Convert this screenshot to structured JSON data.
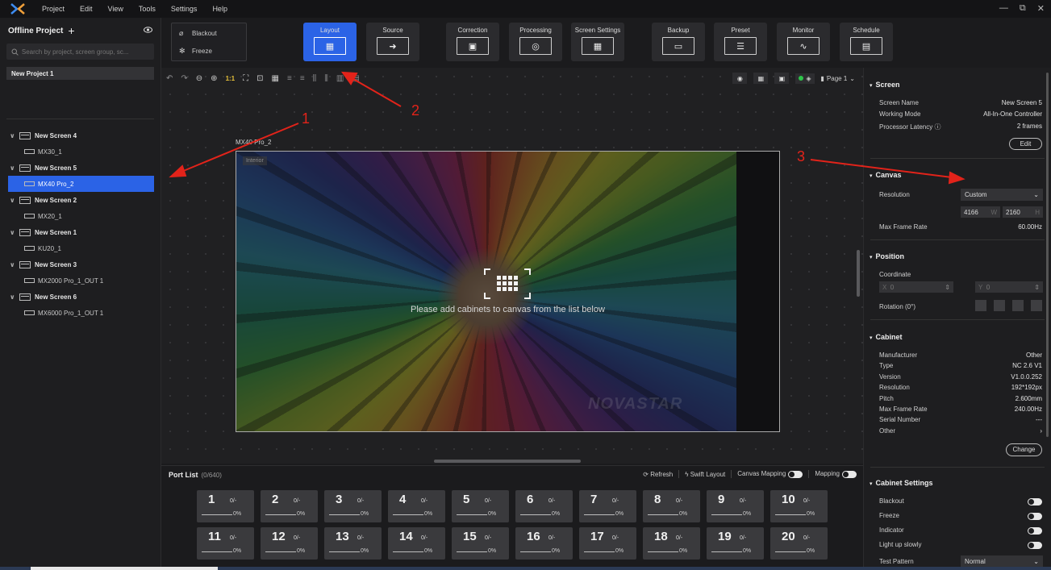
{
  "menu": {
    "items": [
      "Project",
      "Edit",
      "View",
      "Tools",
      "Settings",
      "Help"
    ],
    "window_controls": [
      "—",
      "⧉",
      "✕"
    ]
  },
  "sidebar": {
    "project_title": "Offline Project",
    "add_symbol": "+",
    "search_placeholder": "Search by project, screen group, sc...",
    "project_item": "New Project 1",
    "tree": [
      {
        "screen": "New Screen 4",
        "controller": "MX30_1",
        "selected": false
      },
      {
        "screen": "New Screen 5",
        "controller": "MX40 Pro_2",
        "selected": true
      },
      {
        "screen": "New Screen 2",
        "controller": "MX20_1",
        "selected": false
      },
      {
        "screen": "New Screen 1",
        "controller": "KU20_1",
        "selected": false
      },
      {
        "screen": "New Screen 3",
        "controller": "MX2000 Pro_1_OUT 1",
        "selected": false
      },
      {
        "screen": "New Screen 6",
        "controller": "MX6000 Pro_1_OUT 1",
        "selected": false
      }
    ]
  },
  "toolbar": {
    "blackout_label": "Blackout",
    "freeze_label": "Freeze",
    "tabs": [
      {
        "label": "Layout",
        "icon": "layout-grid-icon",
        "active": true
      },
      {
        "label": "Source",
        "icon": "arrow-right-icon",
        "active": false
      },
      {
        "label": "Correction",
        "icon": "correction-icon",
        "active": false
      },
      {
        "label": "Processing",
        "icon": "color-wheel-icon",
        "active": false
      },
      {
        "label": "Screen Settings",
        "icon": "screen-settings-icon",
        "active": false
      },
      {
        "label": "Backup",
        "icon": "backup-icon",
        "active": false
      },
      {
        "label": "Preset",
        "icon": "sliders-icon",
        "active": false
      },
      {
        "label": "Monitor",
        "icon": "monitor-icon",
        "active": false
      },
      {
        "label": "Schedule",
        "icon": "schedule-icon",
        "active": false
      }
    ]
  },
  "canvas": {
    "zoom_label": "1:1",
    "page_label": "Page 1",
    "screen_label": "MX40 Pro_2",
    "interior_tag": "Interior",
    "watermark": "NOVASTAR",
    "empty_message": "Please add cabinets to canvas from the list below"
  },
  "portlist": {
    "title": "Port List",
    "count": "(0/640)",
    "refresh": "Refresh",
    "swift_layout": "Swift Layout",
    "canvas_mapping": "Canvas Mapping",
    "mapping": "Mapping",
    "ports": [
      {
        "num": "1",
        "frac": "0/-",
        "pct": "0%"
      },
      {
        "num": "2",
        "frac": "0/-",
        "pct": "0%"
      },
      {
        "num": "3",
        "frac": "0/-",
        "pct": "0%"
      },
      {
        "num": "4",
        "frac": "0/-",
        "pct": "0%"
      },
      {
        "num": "5",
        "frac": "0/-",
        "pct": "0%"
      },
      {
        "num": "6",
        "frac": "0/-",
        "pct": "0%"
      },
      {
        "num": "7",
        "frac": "0/-",
        "pct": "0%"
      },
      {
        "num": "8",
        "frac": "0/-",
        "pct": "0%"
      },
      {
        "num": "9",
        "frac": "0/-",
        "pct": "0%"
      },
      {
        "num": "10",
        "frac": "0/-",
        "pct": "0%"
      },
      {
        "num": "11",
        "frac": "0/-",
        "pct": "0%"
      },
      {
        "num": "12",
        "frac": "0/-",
        "pct": "0%"
      },
      {
        "num": "13",
        "frac": "0/-",
        "pct": "0%"
      },
      {
        "num": "14",
        "frac": "0/-",
        "pct": "0%"
      },
      {
        "num": "15",
        "frac": "0/-",
        "pct": "0%"
      },
      {
        "num": "16",
        "frac": "0/-",
        "pct": "0%"
      },
      {
        "num": "17",
        "frac": "0/-",
        "pct": "0%"
      },
      {
        "num": "18",
        "frac": "0/-",
        "pct": "0%"
      },
      {
        "num": "19",
        "frac": "0/-",
        "pct": "0%"
      },
      {
        "num": "20",
        "frac": "0/-",
        "pct": "0%"
      }
    ]
  },
  "rightpanel": {
    "screen": {
      "title": "Screen",
      "name_label": "Screen Name",
      "name_value": "New Screen 5",
      "mode_label": "Working Mode",
      "mode_value": "All-In-One Controller",
      "latency_label": "Processor Latency",
      "latency_value": "2 frames",
      "edit_button": "Edit"
    },
    "canvas": {
      "title": "Canvas",
      "resolution_label": "Resolution",
      "resolution_value": "Custom",
      "width": "4166",
      "width_unit": "W",
      "height": "2160",
      "height_unit": "H",
      "max_frame_label": "Max Frame Rate",
      "max_frame_value": "60.00Hz"
    },
    "position": {
      "title": "Position",
      "coord_label": "Coordinate",
      "x_label": "X",
      "x_value": "0",
      "y_label": "Y",
      "y_value": "0",
      "rotation_label": "Rotation (0°)"
    },
    "cabinet": {
      "title": "Cabinet",
      "rows": [
        {
          "k": "Manufacturer",
          "v": "Other"
        },
        {
          "k": "Type",
          "v": "NC 2.6 V1"
        },
        {
          "k": "Version",
          "v": "V1.0.0.252"
        },
        {
          "k": "Resolution",
          "v": "192*192px"
        },
        {
          "k": "Pitch",
          "v": "2.600mm"
        },
        {
          "k": "Max Frame Rate",
          "v": "240.00Hz"
        },
        {
          "k": "Serial Number",
          "v": "---"
        },
        {
          "k": "Other",
          "v": "›"
        }
      ],
      "change_button": "Change"
    },
    "cabinet_settings": {
      "title": "Cabinet Settings",
      "toggles": [
        "Blackout",
        "Freeze",
        "Indicator",
        "Light up slowly"
      ],
      "test_pattern_label": "Test Pattern",
      "test_pattern_value": "Normal"
    }
  },
  "annotations": [
    "1",
    "2",
    "3"
  ],
  "colors": {
    "accent": "#2b63e6",
    "annotation": "#e2231a",
    "background": "#1b1b1d"
  }
}
